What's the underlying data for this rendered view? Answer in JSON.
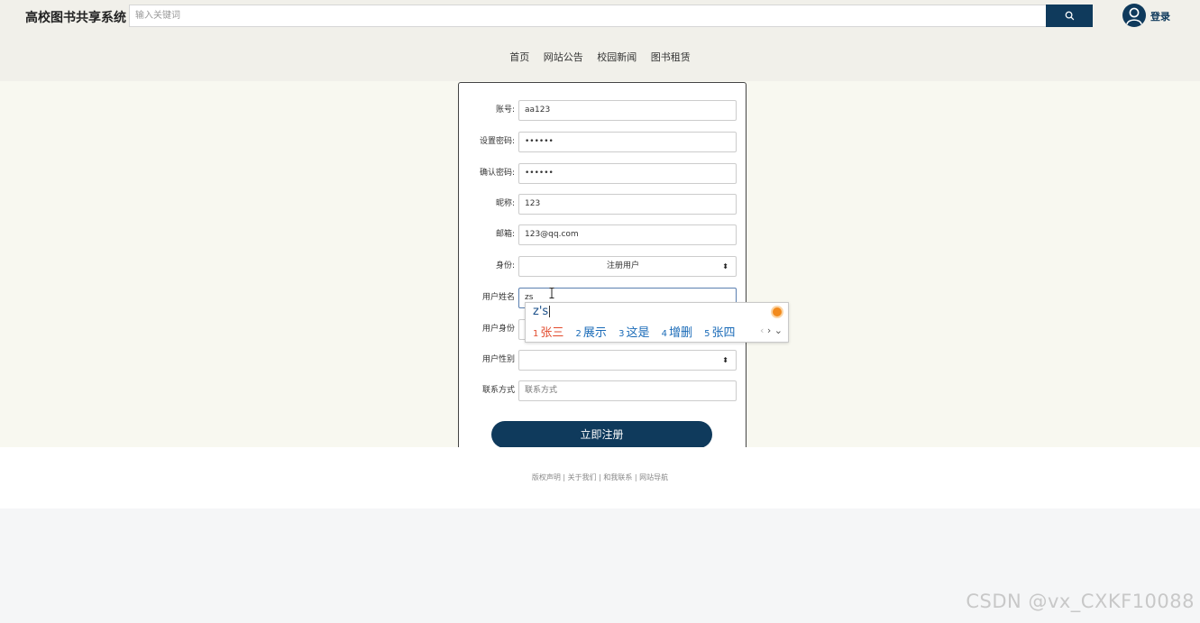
{
  "header": {
    "logo": "高校图书共享系统",
    "search_placeholder": "输入关键词",
    "login_label": "登录"
  },
  "nav": [
    "首页",
    "网站公告",
    "校园新闻",
    "图书租赁"
  ],
  "form": {
    "fields": [
      {
        "label": "账号:",
        "value": "aa123",
        "type": "text"
      },
      {
        "label": "设置密码:",
        "value": "••••••",
        "type": "password"
      },
      {
        "label": "确认密码:",
        "value": "••••••",
        "type": "password"
      },
      {
        "label": "昵称:",
        "value": "123",
        "type": "text"
      },
      {
        "label": "邮箱:",
        "value": "123@qq.com",
        "type": "text"
      },
      {
        "label": "身份:",
        "value": "注册用户",
        "type": "select"
      },
      {
        "label": "用户姓名",
        "value": "zs",
        "type": "text",
        "active": true
      },
      {
        "label": "用户身份",
        "value": "",
        "type": "text"
      },
      {
        "label": "用户性别",
        "value": "",
        "type": "select"
      },
      {
        "label": "联系方式",
        "value": "联系方式",
        "type": "placeholder"
      }
    ],
    "submit_label": "立即注册"
  },
  "footer": {
    "links": [
      "版权声明",
      "关于我们",
      "和我联系",
      "网站导航"
    ]
  },
  "ime": {
    "composition": "z's",
    "candidates": [
      {
        "n": "1",
        "text": "张三"
      },
      {
        "n": "2",
        "text": "展示"
      },
      {
        "n": "3",
        "text": "这是"
      },
      {
        "n": "4",
        "text": "增删"
      },
      {
        "n": "5",
        "text": "张四"
      }
    ]
  },
  "watermark": "CSDN @vx_CXKF10088",
  "colors": {
    "primary": "#0f3a5c",
    "header_bg": "#f1f0ea",
    "content_bg": "#f8f8f0"
  }
}
